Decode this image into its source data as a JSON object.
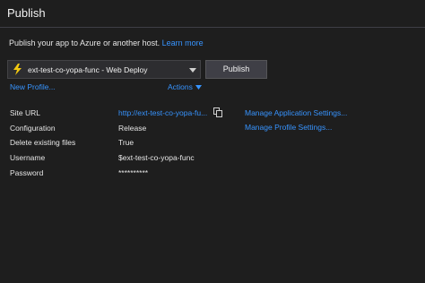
{
  "header": {
    "title": "Publish"
  },
  "intro": {
    "text": "Publish your app to Azure or another host.",
    "link": "Learn more"
  },
  "profile": {
    "selected": "ext-test-co-yopa-func - Web Deploy"
  },
  "buttons": {
    "publish": "Publish",
    "new_profile": "New Profile...",
    "actions": "Actions"
  },
  "details": {
    "site_url_label": "Site URL",
    "site_url_value": "http://ext-test-co-yopa-fu...",
    "configuration_label": "Configuration",
    "configuration_value": "Release",
    "delete_label": "Delete existing files",
    "delete_value": "True",
    "username_label": "Username",
    "username_value": "$ext-test-co-yopa-func",
    "password_label": "Password",
    "password_value": "**********"
  },
  "side_links": {
    "manage_app": "Manage Application Settings...",
    "manage_profile": "Manage Profile Settings..."
  },
  "colors": {
    "link": "#3794ff",
    "background": "#1e1e1e",
    "bolt": "#f2c811"
  }
}
